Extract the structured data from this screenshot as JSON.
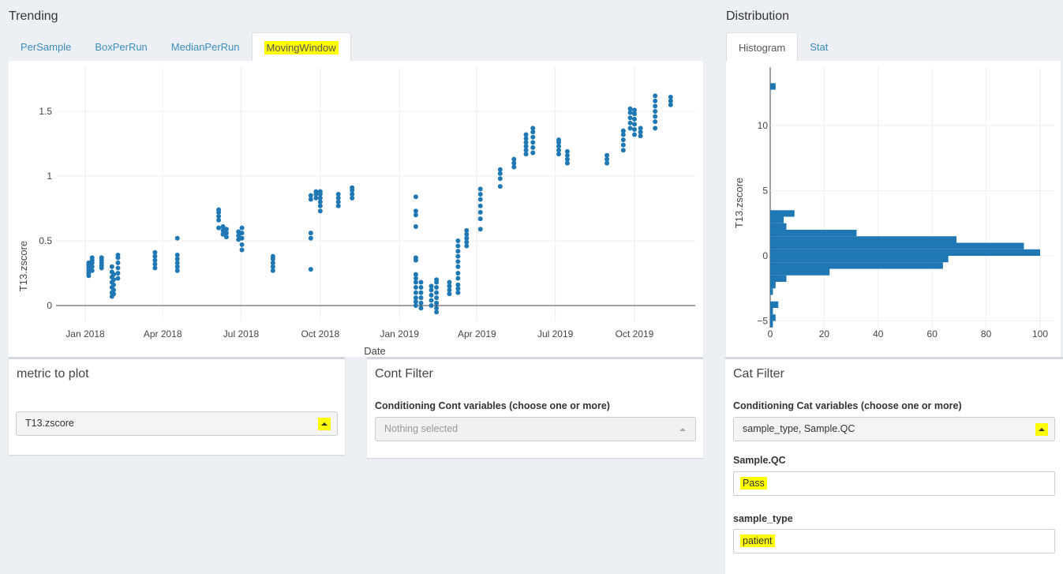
{
  "trending": {
    "title": "Trending",
    "tabs": [
      {
        "label": "PerSample",
        "active": false
      },
      {
        "label": "BoxPerRun",
        "active": false
      },
      {
        "label": "MedianPerRun",
        "active": false
      },
      {
        "label": "MovingWindow",
        "active": true,
        "highlighted": true
      }
    ]
  },
  "distribution": {
    "title": "Distribution",
    "tabs": [
      {
        "label": "Histogram",
        "active": true
      },
      {
        "label": "Stat",
        "active": false
      }
    ]
  },
  "metric_box": {
    "title": "metric to plot",
    "selected": "T13.zscore"
  },
  "cont_filter": {
    "title": "Cont Filter",
    "label": "Conditioning Cont variables (choose one or more)",
    "placeholder": "Nothing selected"
  },
  "cat_filter": {
    "title": "Cat Filter",
    "label": "Conditioning Cat variables (choose one or more)",
    "selected": "sample_type, Sample.QC",
    "fields": [
      {
        "label": "Sample.QC",
        "value": "Pass"
      },
      {
        "label": "sample_type",
        "value": "patient"
      }
    ]
  },
  "colors": {
    "marker": "#1f77b4",
    "highlight": "#ffff00",
    "link": "#3c8dbc",
    "background": "#ecf0f5"
  },
  "chart_data": [
    {
      "type": "scatter",
      "xlabel": "Date",
      "ylabel": "T13.zscore",
      "x_ticks": [
        "Jan 2018",
        "Apr 2018",
        "Jul 2018",
        "Oct 2018",
        "Jan 2019",
        "Apr 2019",
        "Jul 2019",
        "Oct 2019"
      ],
      "y_ticks": [
        "0",
        "0.5",
        "1",
        "1.5"
      ],
      "ylim": [
        -0.1,
        1.75
      ],
      "grid": true,
      "series": [
        {
          "points": [
            {
              "x": "2018-01-05",
              "y": [
                0.23,
                0.25,
                0.27,
                0.29,
                0.31,
                0.33
              ]
            },
            {
              "x": "2018-01-09",
              "y": [
                0.27,
                0.3,
                0.33,
                0.35,
                0.37
              ]
            },
            {
              "x": "2018-01-20",
              "y": [
                0.29,
                0.31,
                0.33,
                0.35,
                0.37
              ]
            },
            {
              "x": "2018-02-01",
              "y": [
                0.07,
                0.1,
                0.14,
                0.18,
                0.22,
                0.26,
                0.3
              ]
            },
            {
              "x": "2018-02-03",
              "y": [
                0.09,
                0.12,
                0.16,
                0.2,
                0.24
              ]
            },
            {
              "x": "2018-02-08",
              "y": [
                0.21,
                0.25,
                0.29,
                0.33,
                0.37,
                0.39
              ]
            },
            {
              "x": "2018-03-23",
              "y": [
                0.29,
                0.32,
                0.35,
                0.38,
                0.41
              ]
            },
            {
              "x": "2018-04-18",
              "y": [
                0.27,
                0.3,
                0.33,
                0.36,
                0.39,
                0.52
              ]
            },
            {
              "x": "2018-06-05",
              "y": [
                0.6,
                0.66,
                0.69,
                0.72,
                0.74
              ]
            },
            {
              "x": "2018-06-10",
              "y": [
                0.55,
                0.58,
                0.61
              ]
            },
            {
              "x": "2018-06-14",
              "y": [
                0.53,
                0.56,
                0.59
              ]
            },
            {
              "x": "2018-06-28",
              "y": [
                0.51,
                0.54,
                0.57
              ]
            },
            {
              "x": "2018-07-02",
              "y": [
                0.43,
                0.47,
                0.52,
                0.56,
                0.6
              ]
            },
            {
              "x": "2018-08-07",
              "y": [
                0.27,
                0.3,
                0.33,
                0.36,
                0.38
              ]
            },
            {
              "x": "2018-09-20",
              "y": [
                0.28,
                0.52,
                0.56,
                0.82,
                0.85
              ]
            },
            {
              "x": "2018-09-26",
              "y": [
                0.83,
                0.86,
                0.88
              ]
            },
            {
              "x": "2018-10-01",
              "y": [
                0.73,
                0.77,
                0.8,
                0.83,
                0.86,
                0.88
              ]
            },
            {
              "x": "2018-10-22",
              "y": [
                0.77,
                0.8,
                0.83,
                0.86
              ]
            },
            {
              "x": "2018-11-07",
              "y": [
                0.83,
                0.86,
                0.89,
                0.91
              ]
            },
            {
              "x": "2019-01-20",
              "y": [
                0.0,
                0.03,
                0.06,
                0.1,
                0.14,
                0.18,
                0.21,
                0.24,
                0.35,
                0.37,
                0.61,
                0.7,
                0.73,
                0.84
              ]
            },
            {
              "x": "2019-01-26",
              "y": [
                -0.02,
                0.02,
                0.06,
                0.1,
                0.14,
                0.18
              ]
            },
            {
              "x": "2019-02-07",
              "y": [
                0.0,
                0.04,
                0.08,
                0.12,
                0.15
              ]
            },
            {
              "x": "2019-02-13",
              "y": [
                -0.05,
                -0.02,
                0.02,
                0.06,
                0.1,
                0.14,
                0.18,
                0.2
              ]
            },
            {
              "x": "2019-02-28",
              "y": [
                0.09,
                0.12,
                0.15,
                0.18
              ]
            },
            {
              "x": "2019-03-10",
              "y": [
                0.1,
                0.13,
                0.16,
                0.21,
                0.25,
                0.3,
                0.34,
                0.38,
                0.42,
                0.46,
                0.5
              ]
            },
            {
              "x": "2019-03-20",
              "y": [
                0.46,
                0.49,
                0.52,
                0.55,
                0.58
              ]
            },
            {
              "x": "2019-04-05",
              "y": [
                0.59,
                0.67,
                0.72,
                0.77,
                0.82,
                0.86,
                0.9
              ]
            },
            {
              "x": "2019-04-28",
              "y": [
                0.92,
                0.98,
                1.02,
                1.05
              ]
            },
            {
              "x": "2019-05-14",
              "y": [
                1.07,
                1.1,
                1.13
              ]
            },
            {
              "x": "2019-05-28",
              "y": [
                1.17,
                1.2,
                1.23,
                1.26,
                1.29,
                1.32
              ]
            },
            {
              "x": "2019-06-05",
              "y": [
                1.18,
                1.22,
                1.26,
                1.3,
                1.34,
                1.37
              ]
            },
            {
              "x": "2019-07-05",
              "y": [
                1.17,
                1.2,
                1.23,
                1.26,
                1.28
              ]
            },
            {
              "x": "2019-07-15",
              "y": [
                1.1,
                1.13,
                1.16,
                1.19
              ]
            },
            {
              "x": "2019-08-30",
              "y": [
                1.1,
                1.13,
                1.16
              ]
            },
            {
              "x": "2019-09-18",
              "y": [
                1.2,
                1.24,
                1.28,
                1.32,
                1.35
              ]
            },
            {
              "x": "2019-09-26",
              "y": [
                1.37,
                1.41,
                1.45,
                1.49,
                1.52
              ]
            },
            {
              "x": "2019-10-01",
              "y": [
                1.32,
                1.36,
                1.4,
                1.44,
                1.48,
                1.51
              ]
            },
            {
              "x": "2019-10-08",
              "y": [
                1.31,
                1.34,
                1.37
              ]
            },
            {
              "x": "2019-10-25",
              "y": [
                1.37,
                1.42,
                1.46,
                1.5,
                1.54,
                1.58,
                1.62
              ]
            },
            {
              "x": "2019-11-12",
              "y": [
                1.55,
                1.58,
                1.61
              ]
            }
          ]
        }
      ]
    },
    {
      "type": "bar",
      "orientation": "horizontal",
      "ylabel": "T13.zscore",
      "x_ticks": [
        "0",
        "20",
        "40",
        "60",
        "80",
        "100"
      ],
      "y_ticks": [
        "−5",
        "0",
        "5",
        "10"
      ],
      "xlim": [
        0,
        100
      ],
      "ylim": [
        -5.5,
        13.5
      ],
      "bins": [
        {
          "y": 13,
          "count": 2
        },
        {
          "y": 3.25,
          "count": 9
        },
        {
          "y": 2.75,
          "count": 5
        },
        {
          "y": 2.25,
          "count": 6
        },
        {
          "y": 1.75,
          "count": 32
        },
        {
          "y": 1.25,
          "count": 69
        },
        {
          "y": 0.75,
          "count": 94
        },
        {
          "y": 0.25,
          "count": 100
        },
        {
          "y": -0.25,
          "count": 66
        },
        {
          "y": -0.75,
          "count": 64
        },
        {
          "y": -1.25,
          "count": 22
        },
        {
          "y": -1.75,
          "count": 6
        },
        {
          "y": -2.25,
          "count": 2
        },
        {
          "y": -2.75,
          "count": 1
        },
        {
          "y": -3.25,
          "count": 0
        },
        {
          "y": -3.75,
          "count": 3
        },
        {
          "y": -4.25,
          "count": 1
        },
        {
          "y": -4.75,
          "count": 2
        },
        {
          "y": -5.25,
          "count": 1
        }
      ]
    }
  ]
}
